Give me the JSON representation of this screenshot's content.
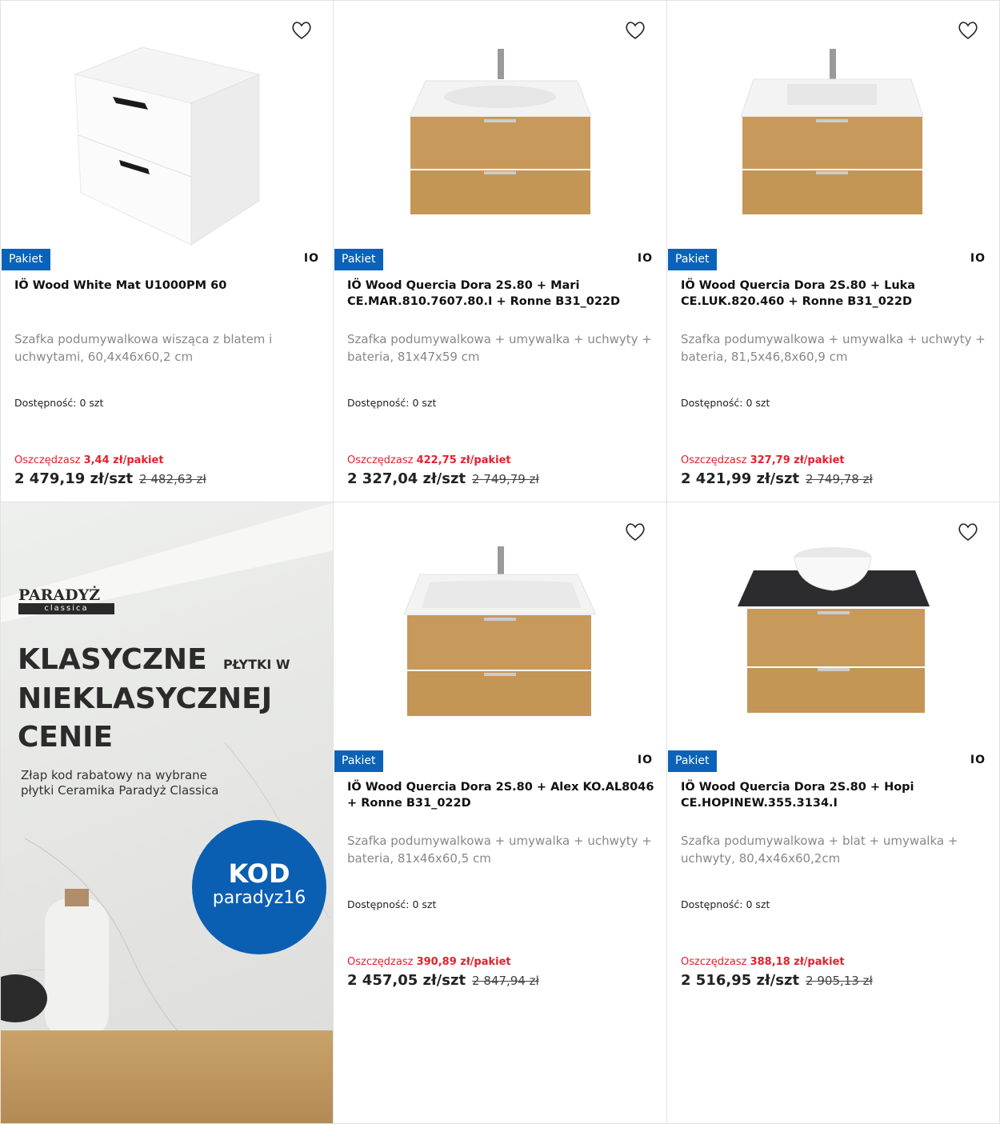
{
  "common": {
    "badge": "Pakiet",
    "brand": "IO",
    "availability_label": "Dostępność:",
    "save_label": "Oszczędzasz"
  },
  "products": [
    {
      "title": "IÖ Wood White Mat U1000PM 60",
      "description": "Szafka podumywalkowa wisząca z blatem i uchwytami, 60,4x46x60,2 cm",
      "availability": "0 szt",
      "save_amount": "3,44 zł/pakiet",
      "price": "2 479,19 zł/szt",
      "old_price": "2 482,63 zł",
      "image": "white-cabinet"
    },
    {
      "title": "IÖ Wood Quercia Dora 2S.80 + Mari CE.MAR.810.7607.80.I + Ronne B31_022D",
      "description": "Szafka podumywalkowa + umywalka + uchwyty + bateria, 81x47x59 cm",
      "availability": "0 szt",
      "save_amount": "422,75 zł/pakiet",
      "price": "2 327,04 zł/szt",
      "old_price": "2 749,79 zł",
      "image": "oak-cabinet-sink"
    },
    {
      "title": "IÖ Wood Quercia Dora 2S.80 + Luka CE.LUK.820.460 + Ronne B31_022D",
      "description": "Szafka podumywalkowa + umywalka + uchwyty + bateria, 81,5x46,8x60,9 cm",
      "availability": "0 szt",
      "save_amount": "327,79 zł/pakiet",
      "price": "2 421,99 zł/szt",
      "old_price": "2 749,78 zł",
      "image": "oak-cabinet-sink"
    },
    {
      "title": "IÖ Wood Quercia Dora 2S.80 + Alex KO.AL8046 + Ronne B31_022D",
      "description": "Szafka podumywalkowa + umywalka + uchwyty + bateria, 81x46x60,5 cm",
      "availability": "0 szt",
      "save_amount": "390,89 zł/pakiet",
      "price": "2 457,05 zł/szt",
      "old_price": "2 847,94 zł",
      "image": "oak-cabinet-sink"
    },
    {
      "title": "IÖ Wood Quercia Dora 2S.80 + Hopi CE.HOPINEW.355.3134.I",
      "description": "Szafka podumywalkowa + blat + umywalka + uchwyty, 80,4x46x60,2cm",
      "availability": "0 szt",
      "save_amount": "388,18 zł/pakiet",
      "price": "2 516,95 zł/szt",
      "old_price": "2 905,13 zł",
      "image": "oak-cabinet-bowl"
    }
  ],
  "banner": {
    "logo": "PARADYŻ",
    "logo_sub": "classica",
    "line1": "KLASYCZNE",
    "line1_small": "PŁYTKI W",
    "line2": "NIEKLASYCZNEJ",
    "line3": "CENIE",
    "subtitle": "Złap kod rabatowy na wybrane płytki Ceramika Paradyż Classica",
    "kod_label": "KOD",
    "kod_value": "paradyz16"
  },
  "colors": {
    "badge": "#0a63b8",
    "save": "#e4202c",
    "oak": "#c79a5c",
    "kod_circle": "#0a5fb3"
  }
}
